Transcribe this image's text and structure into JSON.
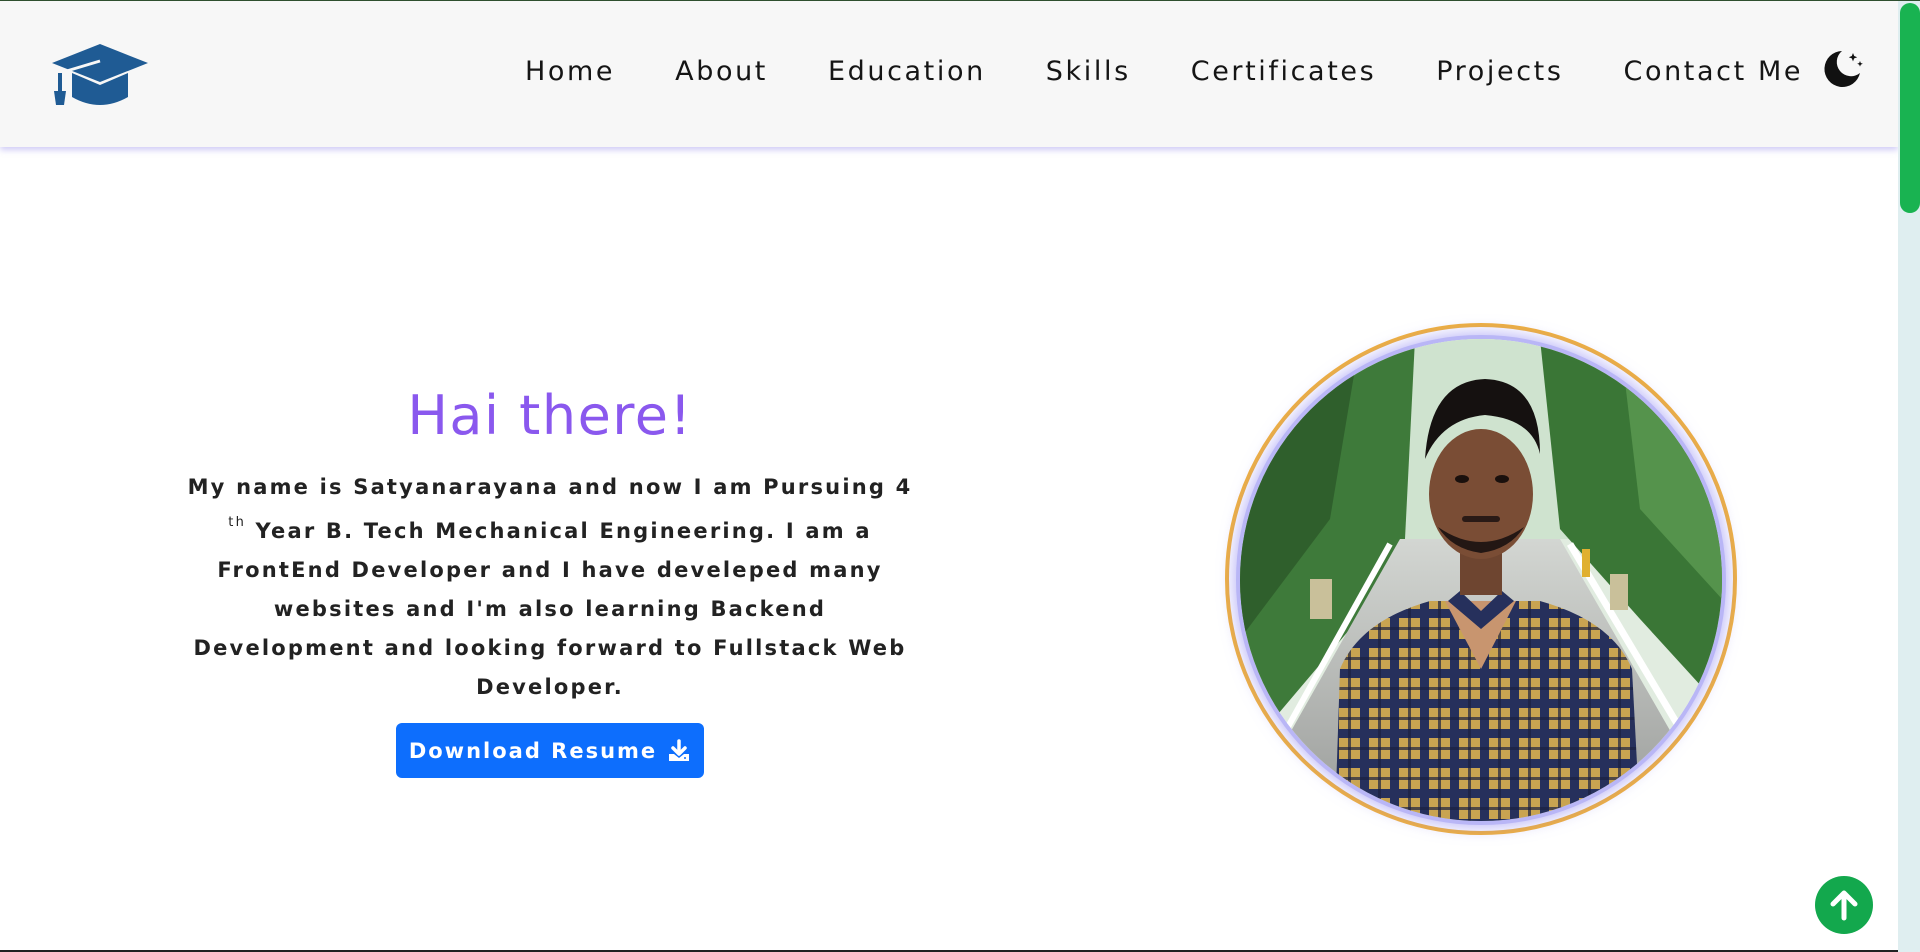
{
  "nav": {
    "items": [
      {
        "label": "Home"
      },
      {
        "label": "About"
      },
      {
        "label": "Education"
      },
      {
        "label": "Skills"
      },
      {
        "label": "Certificates"
      },
      {
        "label": "Projects"
      },
      {
        "label": "Contact Me"
      }
    ],
    "logo_icon": "graduation-cap-icon",
    "theme_icon": "moon-stars-icon"
  },
  "hero": {
    "heading": "Hai there!",
    "intro_part1": "My name is Satyanarayana and now I am Pursuing 4",
    "intro_sup": "th",
    "intro_part2": "Year B. Tech Mechanical Engineering. I am a FrontEnd Developer and I have develeped many websites and I'm also learning Backend Development and looking forward to Fullstack Web Developer.",
    "download_label": "Download Resume",
    "download_icon": "download-icon"
  },
  "scroll_top_icon": "arrow-up-icon",
  "colors": {
    "heading": "#8a58ee",
    "button": "#0d6efd",
    "logo": "#1f5b94",
    "ring": "#f2b13a",
    "scroll_top": "#13a84d"
  }
}
